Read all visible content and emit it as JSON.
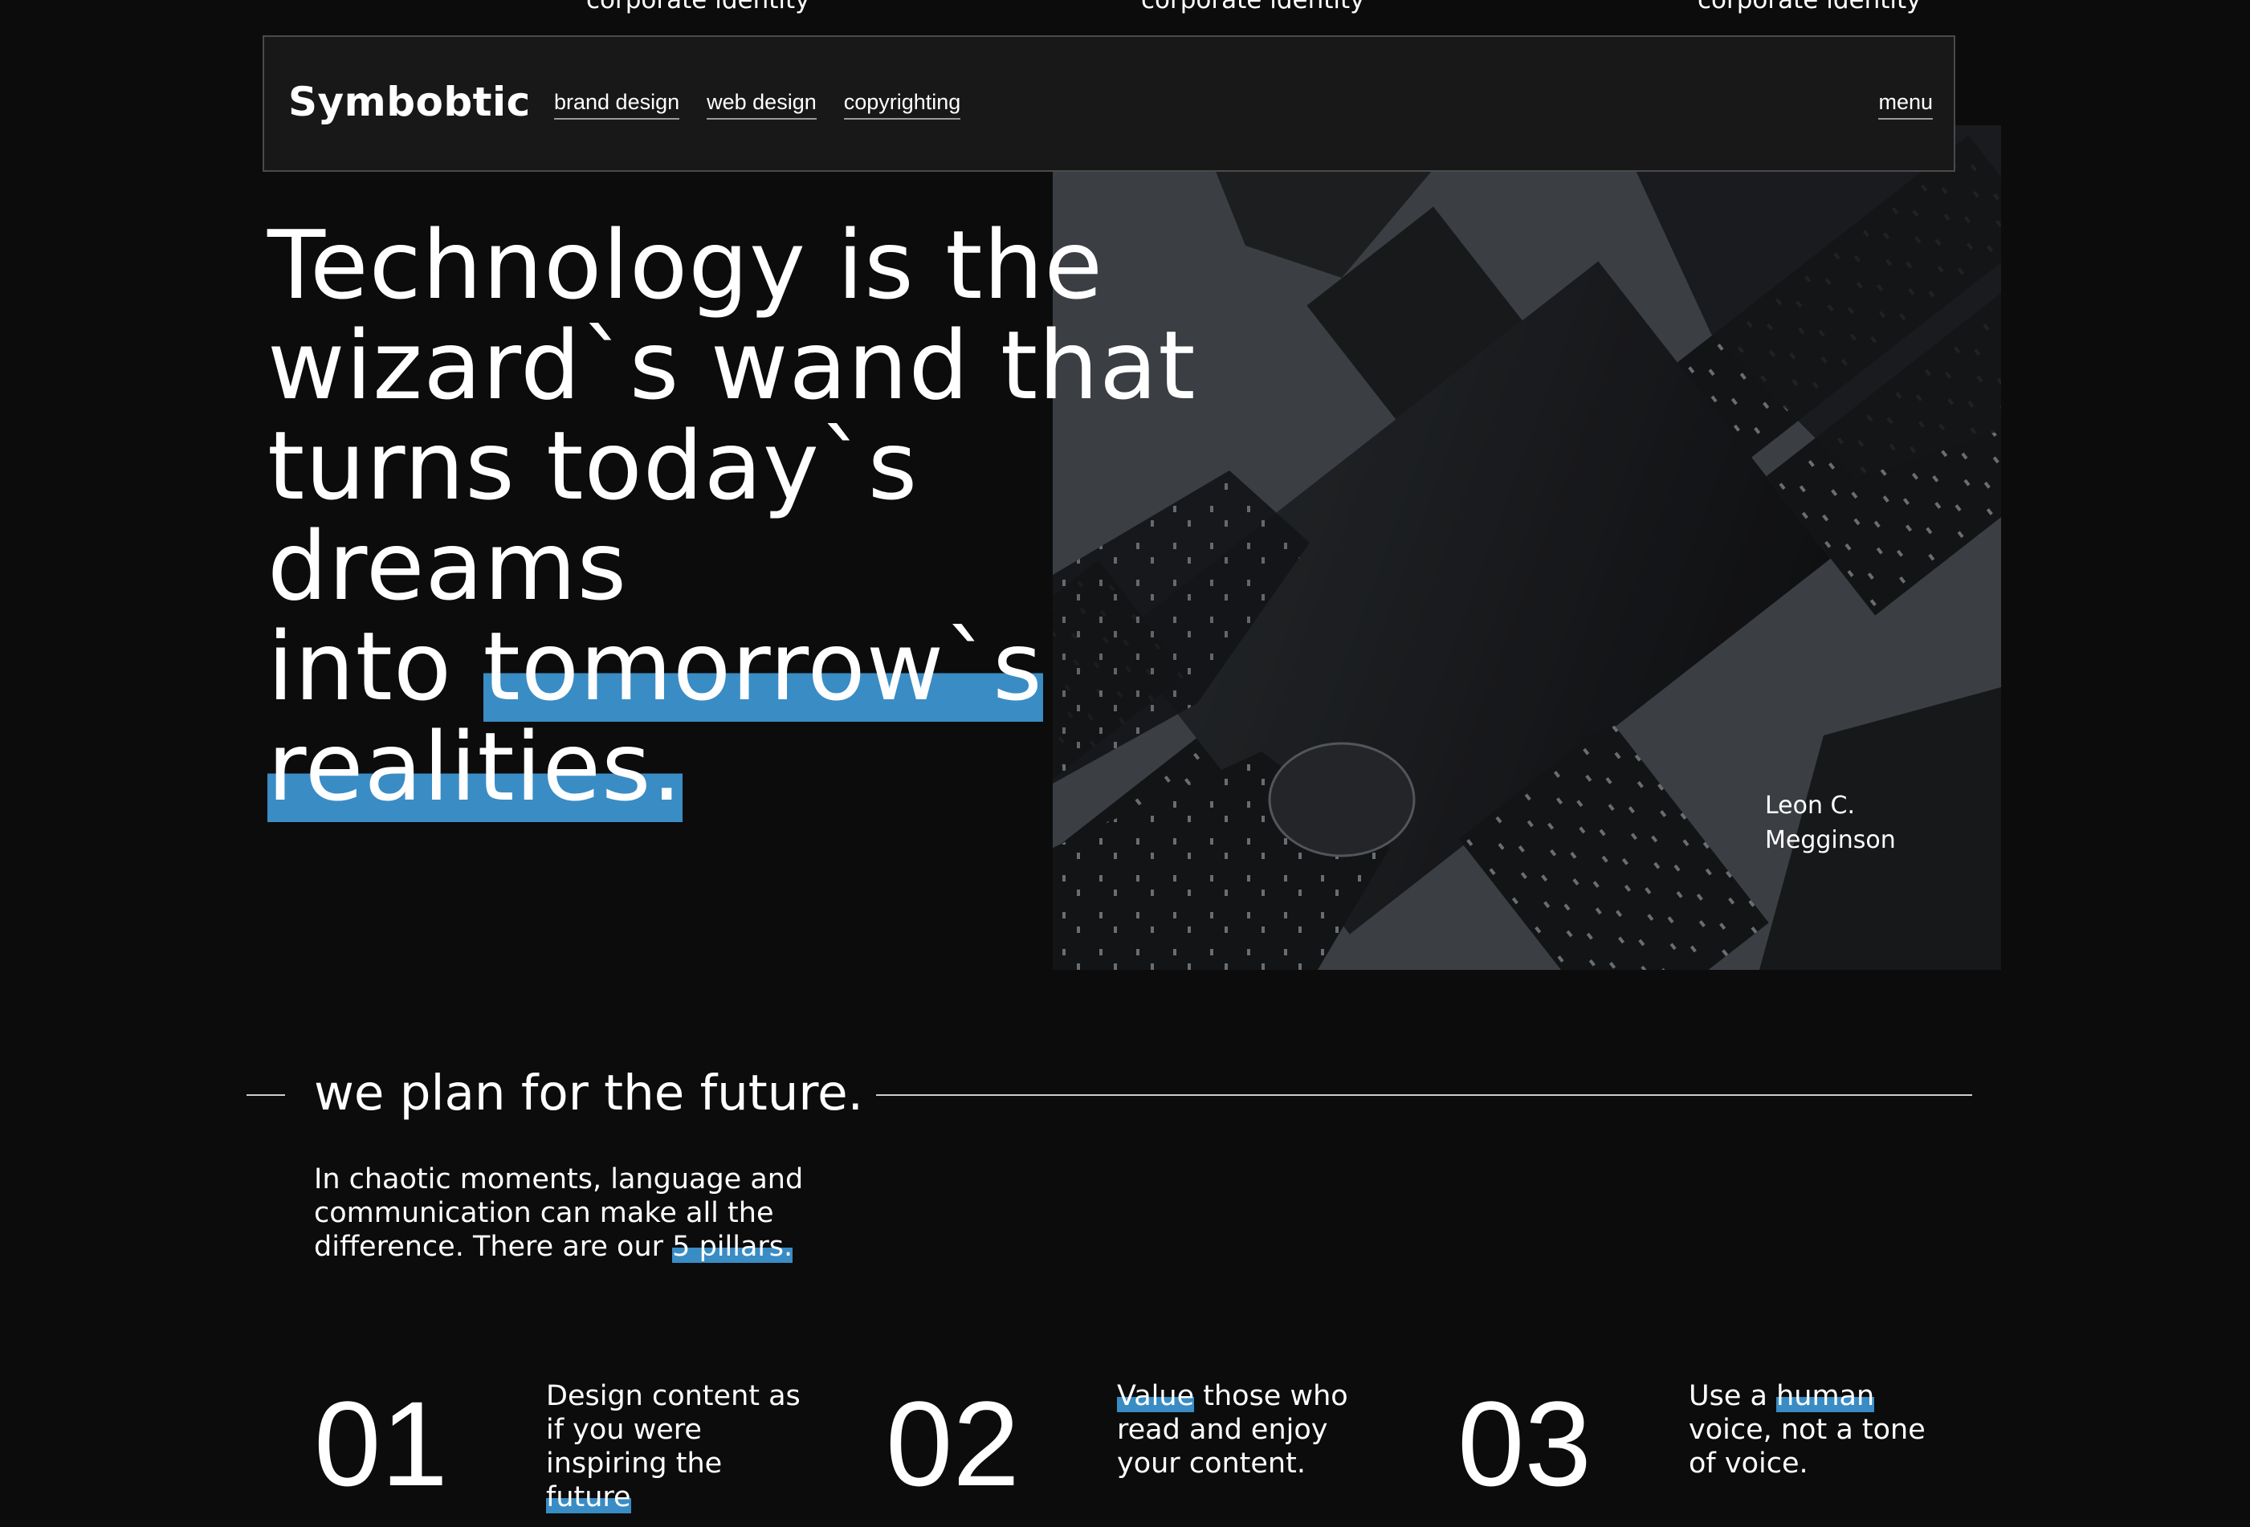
{
  "ticker": [
    "corporate identity",
    "corporate identity",
    "corporate identity"
  ],
  "nav": {
    "logo": "Symbobtic",
    "links": [
      "brand design",
      "web design",
      "copyrighting"
    ],
    "menu": "menu"
  },
  "hero": {
    "line1": "Technology is the",
    "line2": "wizard`s wand that",
    "line3": "turns today`s dreams",
    "line4_pre": "into ",
    "line4_hl": "tomorrow`s",
    "line5_hl": "realities.",
    "author_line1": "Leon C.",
    "author_line2": "Megginson"
  },
  "section": {
    "title": "we plan for the future.",
    "intro_pre": "In chaotic moments, language and communication can make all the difference. There are our ",
    "intro_hl": "5 pillars."
  },
  "pillars": [
    {
      "num": "01",
      "pre": "Design content as if you were inspiring the ",
      "hl": "future",
      "post": ""
    },
    {
      "num": "02",
      "pre": "",
      "hl": "Value",
      "post": " those who read and enjoy your content."
    },
    {
      "num": "03",
      "pre": "Use a ",
      "hl": "human",
      "post": " voice, not a tone of voice."
    }
  ],
  "colors": {
    "background": "#0c0c0c",
    "accent": "#3a8cc4",
    "navbar": "#181818"
  }
}
